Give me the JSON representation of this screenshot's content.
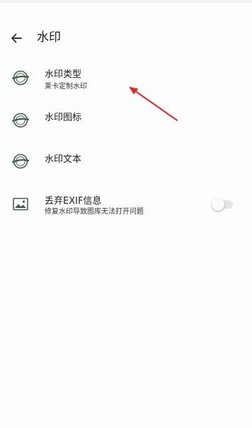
{
  "header": {
    "title": "水印",
    "back_icon": "arrow-left-icon"
  },
  "settings": [
    {
      "label": "水印类型",
      "sub": "莱卡定制水印",
      "icon": "watermark-badge-icon"
    },
    {
      "label": "水印图标",
      "icon": "watermark-badge-icon"
    },
    {
      "label": "水印文本",
      "icon": "watermark-badge-icon"
    },
    {
      "label": "丢弃EXIF信息",
      "sub": "修复水印导致图库无法打开问题",
      "icon": "image-icon",
      "toggle_on": false
    }
  ],
  "colors": {
    "icon": "#3e5c49",
    "annotation_arrow": "#e02a2a",
    "toggle_track": "#e4e4e4"
  }
}
